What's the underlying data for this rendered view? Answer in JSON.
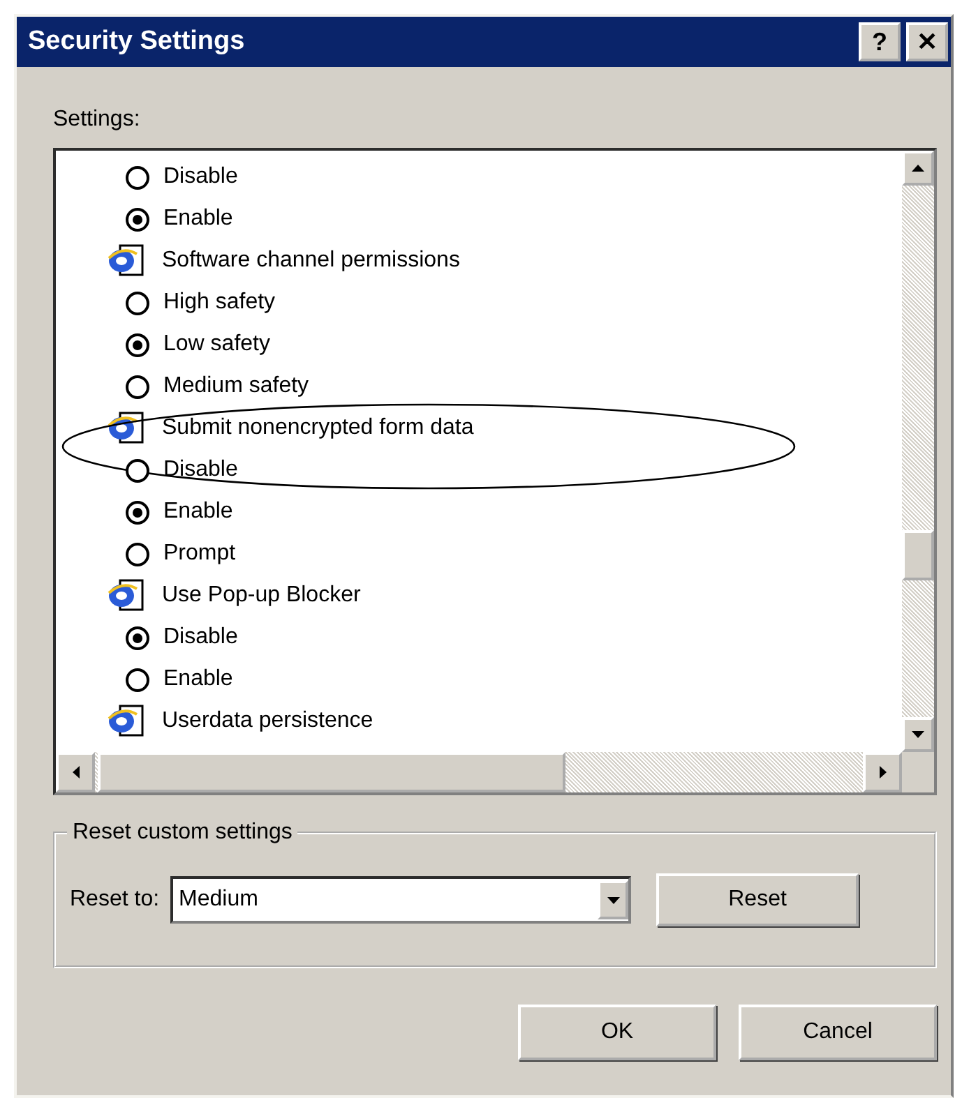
{
  "window": {
    "title": "Security Settings",
    "help_button": "?",
    "close_button": "✕"
  },
  "settings_label": "Settings:",
  "settings": [
    {
      "children": [
        {
          "label": "Disable",
          "selected": false
        },
        {
          "label": "Enable",
          "selected": true
        }
      ]
    },
    {
      "label": "Software channel permissions",
      "children": [
        {
          "label": "High safety",
          "selected": false
        },
        {
          "label": "Low safety",
          "selected": true
        },
        {
          "label": "Medium safety",
          "selected": false
        }
      ]
    },
    {
      "label": "Submit nonencrypted form data",
      "children": [
        {
          "label": "Disable",
          "selected": false
        },
        {
          "label": "Enable",
          "selected": true
        },
        {
          "label": "Prompt",
          "selected": false
        }
      ]
    },
    {
      "label": "Use Pop-up Blocker",
      "children": [
        {
          "label": "Disable",
          "selected": true
        },
        {
          "label": "Enable",
          "selected": false
        }
      ]
    },
    {
      "label": "Userdata persistence"
    }
  ],
  "reset_group": {
    "title": "Reset custom settings",
    "label": "Reset to:",
    "value": "Medium",
    "button": "Reset"
  },
  "buttons": [
    "OK",
    "Cancel"
  ]
}
